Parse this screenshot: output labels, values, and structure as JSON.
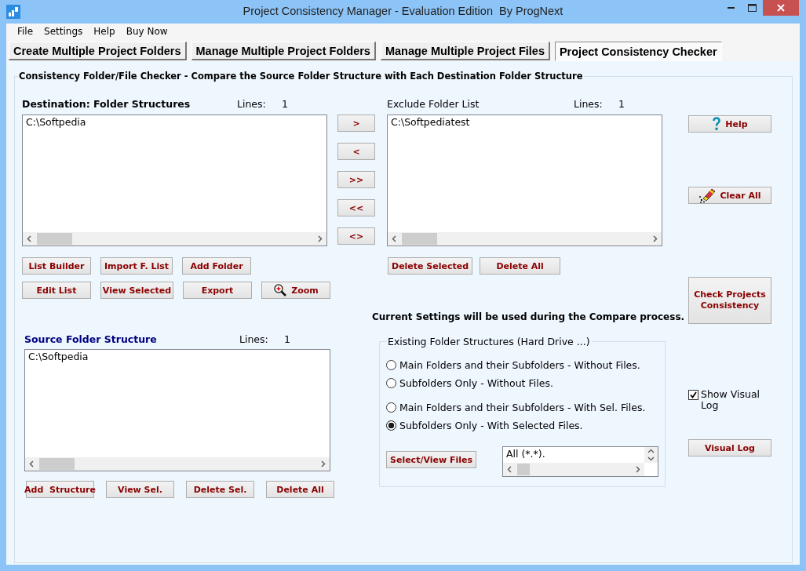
{
  "window": {
    "title": "Project Consistency Manager - Evaluation Edition  By ProgNext"
  },
  "menu": [
    "File",
    "Settings",
    "Help",
    "Buy Now"
  ],
  "tabs": [
    {
      "label": "Create Multiple Project Folders",
      "selected": false
    },
    {
      "label": "Manage Multiple Project Folders",
      "selected": false
    },
    {
      "label": "Manage Multiple Project Files",
      "selected": false
    },
    {
      "label": "Project Consistency Checker",
      "selected": true
    }
  ],
  "panel": {
    "title": "Consistency Folder/File Checker - Compare the Source Folder Structure with Each Destination Folder Structure"
  },
  "destination": {
    "title": "Destination: Folder Structures",
    "lines_label": "Lines:",
    "lines": "1",
    "items": [
      "C:\\Softpedia"
    ],
    "buttons": [
      {
        "label": "List Builder",
        "kind": "plain"
      },
      {
        "label": "Import F. List",
        "kind": "plain"
      },
      {
        "label": "Add Folder",
        "kind": "plain"
      },
      {
        "label": "Edit List",
        "kind": "plain"
      },
      {
        "label": "View Selected",
        "kind": "plain"
      },
      {
        "label": "Export",
        "kind": "plain"
      },
      {
        "label": "Zoom",
        "kind": "zoom"
      }
    ]
  },
  "transfer_buttons": [
    ">",
    "<",
    ">>",
    "<<",
    "<>"
  ],
  "exclude": {
    "title": "Exclude Folder List",
    "lines_label": "Lines:",
    "lines": "1",
    "items": [
      "C:\\Softpediatest"
    ],
    "buttons": [
      "Delete Selected",
      "Delete All"
    ]
  },
  "side_buttons": [
    {
      "label": "Help",
      "kind": "help"
    },
    {
      "label": "Clear All",
      "kind": "clear"
    },
    {
      "label": "Check Projects Consistency",
      "kind": "plain"
    }
  ],
  "show_visual_log": {
    "label": "Show Visual Log",
    "checked": true
  },
  "visual_log_button": "Visual Log",
  "source": {
    "title": "Source Folder Structure",
    "lines_label": "Lines:",
    "lines": "1",
    "items": [
      "C:\\Softpedia"
    ],
    "buttons": [
      "Add  Structure",
      "View Sel.",
      "Delete Sel.",
      "Delete All"
    ]
  },
  "settings_note": "Current Settings will be used during the Compare process.",
  "folder_options": {
    "title": "Existing Folder Structures (Hard Drive ...)",
    "options": [
      {
        "label": "Main Folders and their Subfolders - Without Files.",
        "selected": false
      },
      {
        "label": "Subfolders Only - Without Files.",
        "selected": false
      },
      {
        "label": "Main Folders and their Subfolders - With Sel. Files.",
        "selected": false
      },
      {
        "label": "Subfolders Only - With Selected Files.",
        "selected": true
      }
    ],
    "select_button": "Select/View Files",
    "file_filters": [
      "All (*.*)."
    ]
  }
}
